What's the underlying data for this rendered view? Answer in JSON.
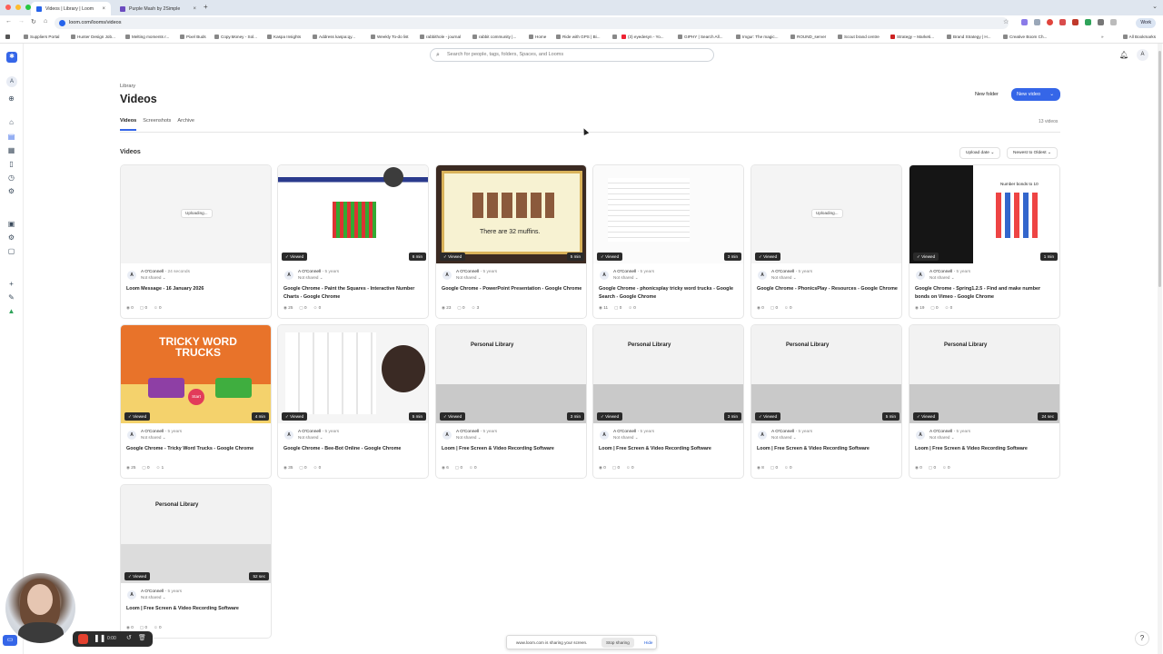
{
  "browser": {
    "tabs": [
      {
        "label": "Videos | Library | Loom",
        "active": true
      },
      {
        "label": "Purple Mash by 2Simple",
        "active": false
      }
    ],
    "url": "loom.com/looms/videos",
    "work_label": "Work",
    "bookmarks": [
      "Suppliers Portal",
      "Hunter Design Job...",
      "Melting moments r...",
      "Pixel Buds",
      "Copy.Money - Sol...",
      "Kaspa Insights",
      "Address kaspa:qy...",
      "Weekly To-do list",
      "rabbithole - journal",
      "rabbit community |...",
      "Home",
      "Ride with GPS | Bi...",
      "(3) eyedesyn - Yo...",
      "GIPHY | Search All...",
      "Imgur: The magic...",
      "ROUND_server",
      "Scout brand centre",
      "Strategy – Marketi...",
      "Brand Strategy | H...",
      "Creative Boom Ch..."
    ],
    "all_bookmarks": "All Bookmarks"
  },
  "search": {
    "placeholder": "Search for people, tags, folders, Spaces, and Looms"
  },
  "user_initial": "A",
  "header": {
    "breadcrumb": "Library",
    "title": "Videos",
    "new_folder": "New folder",
    "new_video": "New video",
    "tabs": [
      "Videos",
      "Screenshots",
      "Archive"
    ],
    "count": "13 videos",
    "section": "Videos",
    "sort_field": "Upload date",
    "sort_order": "Newest to Oldest"
  },
  "videos": [
    {
      "title": "Loom Message - 16 January 2026",
      "author": "A O'Connell",
      "age": "24 seconds",
      "shared": "Not shared",
      "uploading": "Uploading...",
      "views": "0",
      "comments": "0",
      "reactions": "0"
    },
    {
      "title": "Google Chrome - Paint the Squares - Interactive Number Charts - Google Chrome",
      "author": "A O'Connell",
      "age": "5 years",
      "shared": "Not shared",
      "viewed": "Viewed",
      "duration": "6 min",
      "views": "25",
      "comments": "0",
      "reactions": "0"
    },
    {
      "title": "Google Chrome - PowerPoint Presentation - Google Chrome",
      "author": "A O'Connell",
      "age": "5 years",
      "shared": "Not shared",
      "viewed": "Viewed",
      "duration": "5 min",
      "views": "23",
      "comments": "0",
      "reactions": "3",
      "thumb_text": "There are 32 muffins."
    },
    {
      "title": "Google Chrome - phonicsplay tricky word trucks - Google Search - Google Chrome",
      "author": "A O'Connell",
      "age": "5 years",
      "shared": "Not shared",
      "viewed": "Viewed",
      "duration": "3 min",
      "views": "11",
      "comments": "0",
      "reactions": "0"
    },
    {
      "title": "Google Chrome - PhonicsPlay - Resources - Google Chrome",
      "author": "A O'Connell",
      "age": "5 years",
      "shared": "Not shared",
      "viewed": "Viewed",
      "uploading": "Uploading...",
      "views": "0",
      "comments": "0",
      "reactions": "0"
    },
    {
      "title": "Google Chrome - Spring1.2.5 - Find and make number bonds on Vimeo - Google Chrome",
      "author": "A O'Connell",
      "age": "5 years",
      "shared": "Not shared",
      "viewed": "Viewed",
      "duration": "1 min",
      "views": "19",
      "comments": "0",
      "reactions": "0",
      "thumb_text": "Number bonds to 10"
    },
    {
      "title": "Google Chrome - Tricky Word Trucks - Google Chrome",
      "author": "A O'Connell",
      "age": "5 years",
      "shared": "Not shared",
      "viewed": "Viewed",
      "duration": "4 min",
      "views": "25",
      "comments": "0",
      "reactions": "1",
      "thumb_text": "TRICKY WORD TRUCKS",
      "thumb_btn": "Start"
    },
    {
      "title": "Google Chrome - Bee-Bot Online - Google Chrome",
      "author": "A O'Connell",
      "age": "5 years",
      "shared": "Not shared",
      "viewed": "Viewed",
      "duration": "5 min",
      "views": "35",
      "comments": "0",
      "reactions": "0"
    },
    {
      "title": "Loom | Free Screen & Video Recording Software",
      "author": "A O'Connell",
      "age": "5 years",
      "shared": "Not shared",
      "viewed": "Viewed",
      "duration": "3 min",
      "views": "6",
      "comments": "0",
      "reactions": "0",
      "thumb_text": "Personal Library"
    },
    {
      "title": "Loom | Free Screen & Video Recording Software",
      "author": "A O'Connell",
      "age": "5 years",
      "shared": "Not shared",
      "viewed": "Viewed",
      "duration": "3 min",
      "views": "0",
      "comments": "0",
      "reactions": "0",
      "thumb_text": "Personal Library"
    },
    {
      "title": "Loom | Free Screen & Video Recording Software",
      "author": "A O'Connell",
      "age": "5 years",
      "shared": "Not shared",
      "viewed": "Viewed",
      "duration": "5 min",
      "views": "8",
      "comments": "0",
      "reactions": "0",
      "thumb_text": "Personal Library"
    },
    {
      "title": "Loom | Free Screen & Video Recording Software",
      "author": "A O'Connell",
      "age": "5 years",
      "shared": "Not shared",
      "viewed": "Viewed",
      "duration": "24 sec",
      "views": "0",
      "comments": "0",
      "reactions": "0",
      "thumb_text": "Personal Library"
    },
    {
      "title": "Loom | Free Screen & Video Recording Software",
      "author": "A O'Connell",
      "age": "5 years",
      "shared": "Not shared",
      "viewed": "Viewed",
      "duration": "52 sec",
      "views": "0",
      "comments": "0",
      "reactions": "0",
      "thumb_text": "Personal Library"
    }
  ],
  "recorder": {
    "time": "0:00"
  },
  "share_bar": {
    "message": "www.loom.com is sharing your screen.",
    "stop": "Stop sharing",
    "hide": "Hide"
  },
  "help": "?",
  "colors": {
    "accent": "#3566e8",
    "record": "#e4412f"
  }
}
